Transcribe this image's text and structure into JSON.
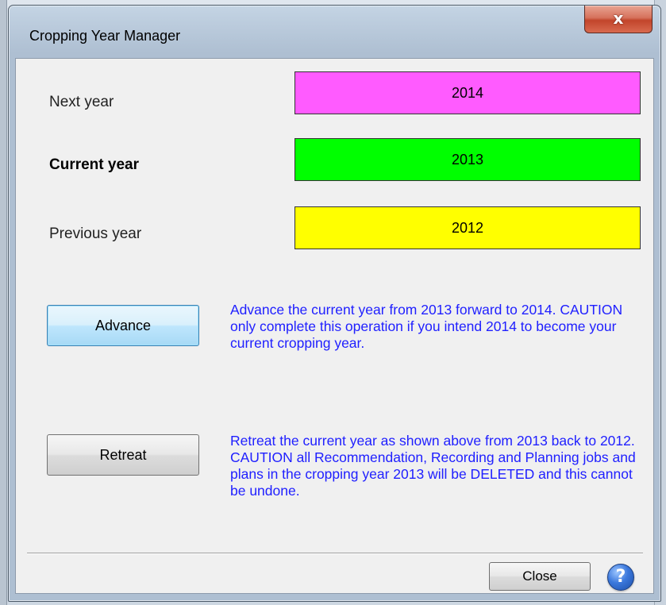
{
  "window": {
    "title": "Cropping Year Manager",
    "close_glyph": "x"
  },
  "years": {
    "next": {
      "label": "Next year",
      "value": "2014",
      "color": "#ff5bff"
    },
    "current": {
      "label": "Current year",
      "value": "2013",
      "color": "#00ff00"
    },
    "previous": {
      "label": "Previous year",
      "value": "2012",
      "color": "#ffff00"
    }
  },
  "actions": {
    "advance": {
      "label": "Advance",
      "description": "Advance the current year from 2013 forward to 2014.  CAUTION only complete this operation if you intend 2014 to become your current cropping year."
    },
    "retreat": {
      "label": "Retreat",
      "description": "Retreat the current year as shown above from 2013 back to 2012.  CAUTION all Recommendation, Recording and Planning jobs and plans in the cropping year 2013 will be DELETED and this cannot be undone."
    }
  },
  "footer": {
    "close_label": "Close",
    "help_glyph": "?"
  },
  "colors": {
    "description_text": "#2020ff"
  }
}
